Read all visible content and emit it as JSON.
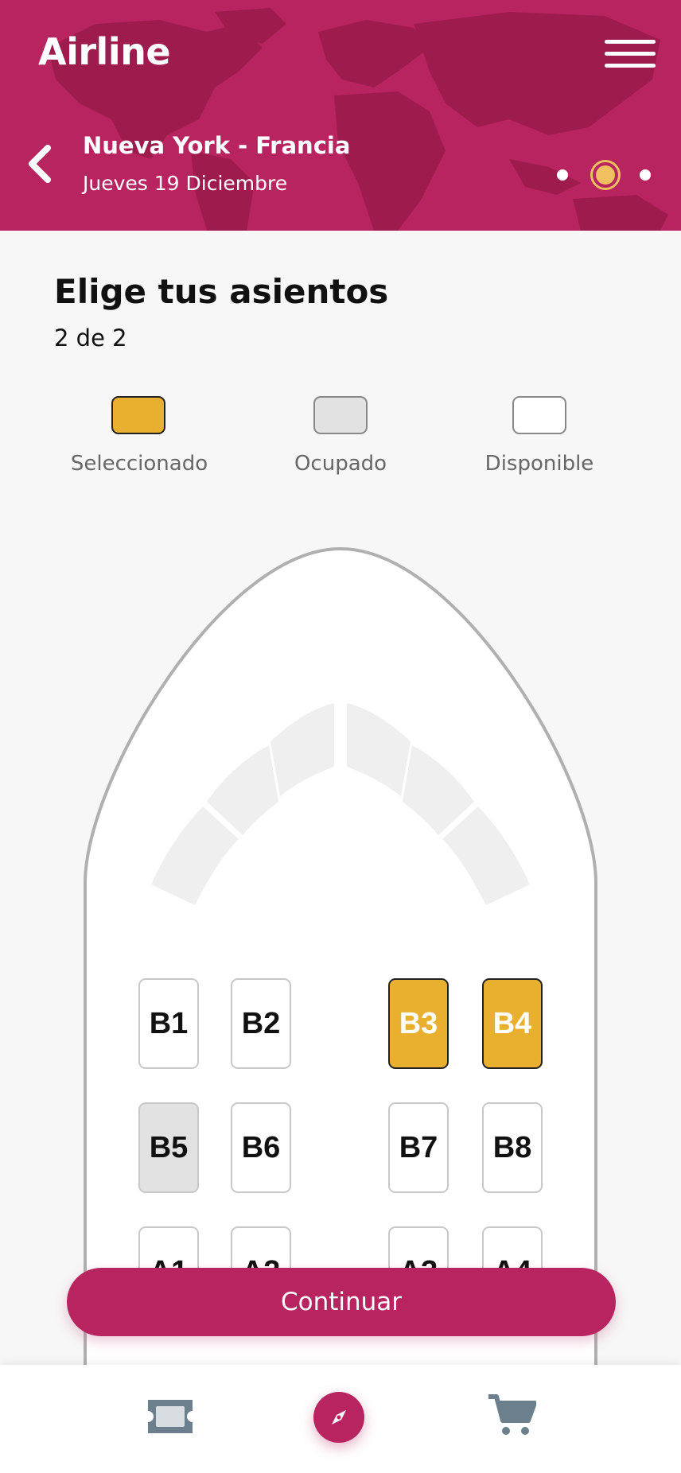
{
  "app": {
    "title": "Airline"
  },
  "trip": {
    "route": "Nueva York - Francia",
    "date": "Jueves 19 Diciembre"
  },
  "steps": {
    "total": 3,
    "active": 2
  },
  "page": {
    "title": "Elige tus asientos",
    "counter": "2 de 2"
  },
  "legend": {
    "selected": "Seleccionado",
    "occupied": "Ocupado",
    "available": "Disponible"
  },
  "seats": [
    {
      "id": "B1",
      "status": "available"
    },
    {
      "id": "B2",
      "status": "available"
    },
    {
      "id": "B3",
      "status": "selected"
    },
    {
      "id": "B4",
      "status": "selected"
    },
    {
      "id": "B5",
      "status": "occupied"
    },
    {
      "id": "B6",
      "status": "available"
    },
    {
      "id": "B7",
      "status": "available"
    },
    {
      "id": "B8",
      "status": "available"
    },
    {
      "id": "A1",
      "status": "available"
    },
    {
      "id": "A2",
      "status": "available"
    },
    {
      "id": "A3",
      "status": "available"
    },
    {
      "id": "A4",
      "status": "available"
    }
  ],
  "actions": {
    "continue": "Continuar"
  },
  "colors": {
    "brand": "#b8245f",
    "selected": "#e8b02e",
    "occupied": "#e2e2e2",
    "available": "#ffffff",
    "nav_icon": "#6b7f8c"
  },
  "bottom_nav": [
    {
      "icon": "ticket-icon"
    },
    {
      "icon": "compass-icon",
      "active": true
    },
    {
      "icon": "cart-icon"
    }
  ]
}
